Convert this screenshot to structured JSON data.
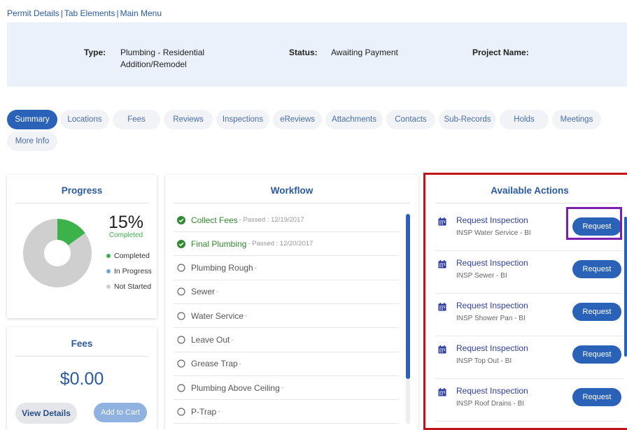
{
  "breadcrumb": {
    "items": [
      "Permit Details",
      "Tab Elements",
      "Main Menu"
    ],
    "separator": "|"
  },
  "info": {
    "type_label": "Type:",
    "type_value_line1": "Plumbing - Residential",
    "type_value_line2": "Addition/Remodel",
    "status_label": "Status:",
    "status_value": "Awaiting Payment",
    "project_label": "Project Name:"
  },
  "tabs": [
    {
      "label": "Summary",
      "active": true
    },
    {
      "label": "Locations"
    },
    {
      "label": "Fees"
    },
    {
      "label": "Reviews"
    },
    {
      "label": "Inspections"
    },
    {
      "label": "eReviews"
    },
    {
      "label": "Attachments"
    },
    {
      "label": "Contacts"
    },
    {
      "label": "Sub-Records"
    },
    {
      "label": "Holds"
    },
    {
      "label": "Meetings"
    },
    {
      "label": "More Info"
    }
  ],
  "progress": {
    "title": "Progress",
    "percent_text": "15%",
    "percent_value": 15,
    "completed_caption": "Completed",
    "legend": [
      {
        "label": "Completed",
        "color": "#3cb34a"
      },
      {
        "label": "In Progress",
        "color": "#6fa6d6"
      },
      {
        "label": "Not Started",
        "color": "#cfcfcf"
      }
    ]
  },
  "fees": {
    "title": "Fees",
    "amount": "$0.00",
    "view_details_label": "View Details",
    "add_to_cart_label": "Add to Cart"
  },
  "workflow": {
    "title": "Workflow",
    "items": [
      {
        "name": "Collect Fees",
        "meta": "- Passed : 12/19/2017",
        "done": true
      },
      {
        "name": "Final Plumbing",
        "meta": "- Passed : 12/20/2017",
        "done": true
      },
      {
        "name": "Plumbing Rough",
        "meta": "-",
        "done": false
      },
      {
        "name": "Sewer",
        "meta": "-",
        "done": false
      },
      {
        "name": "Water Service",
        "meta": "-",
        "done": false
      },
      {
        "name": "Leave Out",
        "meta": "-",
        "done": false
      },
      {
        "name": "Grease Trap",
        "meta": "-",
        "done": false
      },
      {
        "name": "Plumbing Above Ceiling",
        "meta": "-",
        "done": false
      },
      {
        "name": "P-Trap",
        "meta": "-",
        "done": false
      }
    ]
  },
  "actions": {
    "title": "Available Actions",
    "items": [
      {
        "title": "Request Inspection",
        "sub": "INSP Water Service - BI",
        "button": "Request"
      },
      {
        "title": "Request Inspection",
        "sub": "INSP Sewer - BI",
        "button": "Request"
      },
      {
        "title": "Request Inspection",
        "sub": "INSP Shower Pan - BI",
        "button": "Request"
      },
      {
        "title": "Request Inspection",
        "sub": "INSP Top Out - BI",
        "button": "Request"
      },
      {
        "title": "Request Inspection",
        "sub": "INSP Roof Drains - BI",
        "button": "Request"
      }
    ]
  },
  "colors": {
    "accent": "#2a62b8",
    "done_green": "#2e8a2e",
    "highlight_red": "#c0141d",
    "highlight_purple": "#7b1fb0"
  }
}
